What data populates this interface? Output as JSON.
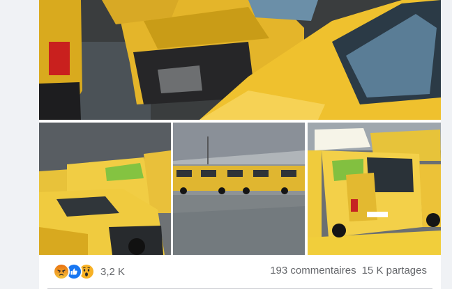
{
  "photos": {
    "main": {
      "icon": "photo-yellow-vans-closeup"
    },
    "left": {
      "icon": "photo-yellow-vans-row"
    },
    "middle": {
      "icon": "photo-vans-parking-lot"
    },
    "right": {
      "icon": "photo-yellow-van-front"
    }
  },
  "reactions": {
    "icons": [
      "angry-reaction-icon",
      "like-reaction-icon",
      "wow-reaction-icon"
    ],
    "count": "3,2 K"
  },
  "stats": {
    "comments": "193 commentaires",
    "shares": "15 K partages"
  },
  "colors": {
    "van_yellow": "#f2c531",
    "like_blue": "#1877f2",
    "angry_red": "#e9710f",
    "wow_yellow": "#f7b125",
    "text_secondary": "#65676b"
  }
}
